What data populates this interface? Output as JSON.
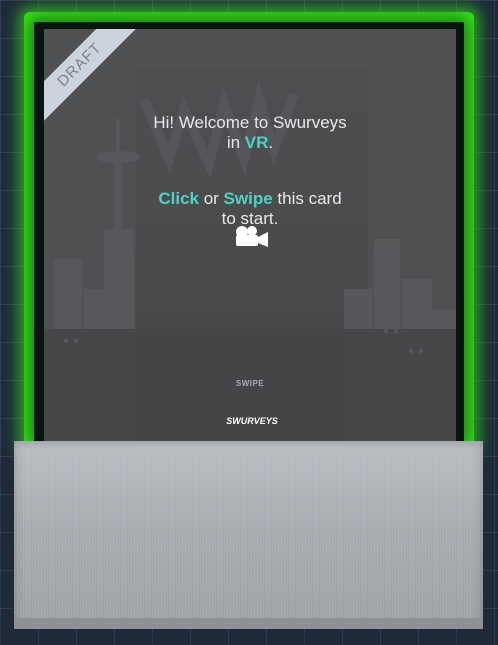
{
  "card": {
    "draft_badge": "DRAFT",
    "welcome_line1": "Hi! Welcome to Swurveys",
    "welcome_line2_prefix": "in ",
    "welcome_vr": "VR",
    "welcome_line2_suffix": ".",
    "instr_click": "Click",
    "instr_or": " or ",
    "instr_swipe": "Swipe",
    "instr_rest": " this card",
    "instr_line2": "to start.",
    "swipe_label": "SWIPE",
    "logo_text": "SWURVEYS"
  },
  "colors": {
    "glow": "#39ff14",
    "accent": "#4fd2c6",
    "card_bg": "#4f5052",
    "base": "#a6abb0"
  },
  "icons": [
    "camera-icon"
  ]
}
